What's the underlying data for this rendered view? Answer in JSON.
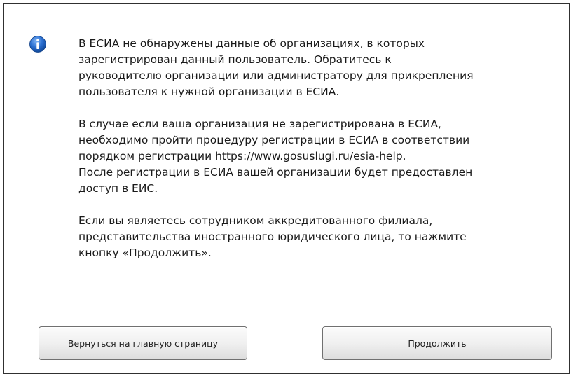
{
  "dialog": {
    "icon": "info-icon",
    "icon_color": "#2a6fd1",
    "paragraphs": [
      {
        "lines": [
          "В ЕСИА не обнаружены данные об организациях, в которых",
          "зарегистрирован данный пользователь. Обратитесь к",
          "руководителю организации или администратору для прикрепления",
          "пользователя к нужной организации в ЕСИА."
        ]
      },
      {
        "lines": [
          "В случае если ваша организация не зарегистрирована в ЕСИА,",
          "необходимо пройти процедуру регистрации в ЕСИА в соответствии",
          "порядком регистрации https://www.gosuslugi.ru/esia-help.",
          "После регистрации в ЕСИА вашей организации будет предоставлен",
          "доступ в ЕИС."
        ]
      },
      {
        "lines": [
          "Если вы являетесь сотрудником аккредитованного филиала,",
          "представительства иностранного юридического лица, то нажмите",
          "кнопку «Продолжить»."
        ]
      }
    ],
    "buttons": {
      "back_label": "Вернуться на главную страницу",
      "continue_label": "Продолжить"
    }
  }
}
